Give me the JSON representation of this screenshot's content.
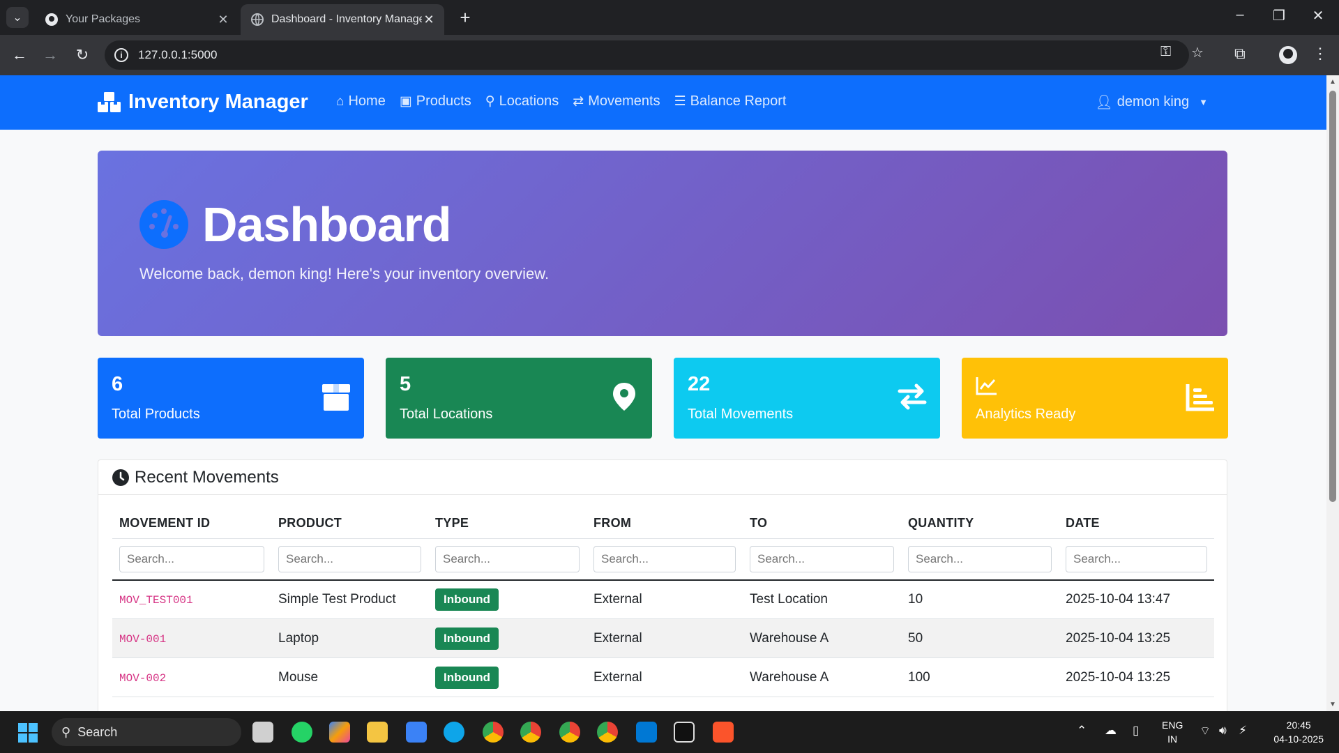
{
  "browser": {
    "tabs": [
      {
        "title": "Your Packages",
        "active": false
      },
      {
        "title": "Dashboard - Inventory Manage",
        "active": true
      }
    ],
    "url": "127.0.0.1:5000"
  },
  "navbar": {
    "brand": "Inventory Manager",
    "links": [
      {
        "label": "Home",
        "icon": "home-icon"
      },
      {
        "label": "Products",
        "icon": "box-icon"
      },
      {
        "label": "Locations",
        "icon": "map-pin-icon"
      },
      {
        "label": "Movements",
        "icon": "exchange-icon"
      },
      {
        "label": "Balance Report",
        "icon": "bar-list-icon"
      }
    ],
    "user": "demon king"
  },
  "hero": {
    "title": "Dashboard",
    "subtitle": "Welcome back, demon king! Here's your inventory overview."
  },
  "stats": [
    {
      "value": "6",
      "label": "Total Products",
      "color": "#0d6efd",
      "icon": "box-icon"
    },
    {
      "value": "5",
      "label": "Total Locations",
      "color": "#198754",
      "icon": "map-pin-icon"
    },
    {
      "value": "22",
      "label": "Total Movements",
      "color": "#0dcaf0",
      "icon": "exchange-icon"
    },
    {
      "value": "",
      "label": "Analytics Ready",
      "color": "#ffc107",
      "icon": "chart-icon"
    }
  ],
  "recent": {
    "title": "Recent Movements",
    "columns": [
      "MOVEMENT ID",
      "PRODUCT",
      "TYPE",
      "FROM",
      "TO",
      "QUANTITY",
      "DATE"
    ],
    "filter_placeholder": "Search...",
    "rows": [
      {
        "id": "MOV_TEST001",
        "product": "Simple Test Product",
        "type": "Inbound",
        "from": "External",
        "to": "Test Location",
        "qty": "10",
        "date": "2025-10-04 13:47"
      },
      {
        "id": "MOV-001",
        "product": "Laptop",
        "type": "Inbound",
        "from": "External",
        "to": "Warehouse A",
        "qty": "50",
        "date": "2025-10-04 13:25"
      },
      {
        "id": "MOV-002",
        "product": "Mouse",
        "type": "Inbound",
        "from": "External",
        "to": "Warehouse A",
        "qty": "100",
        "date": "2025-10-04 13:25"
      }
    ]
  },
  "taskbar": {
    "search": "Search",
    "lang": [
      "ENG",
      "IN"
    ],
    "time": "20:45",
    "date": "04-10-2025"
  }
}
